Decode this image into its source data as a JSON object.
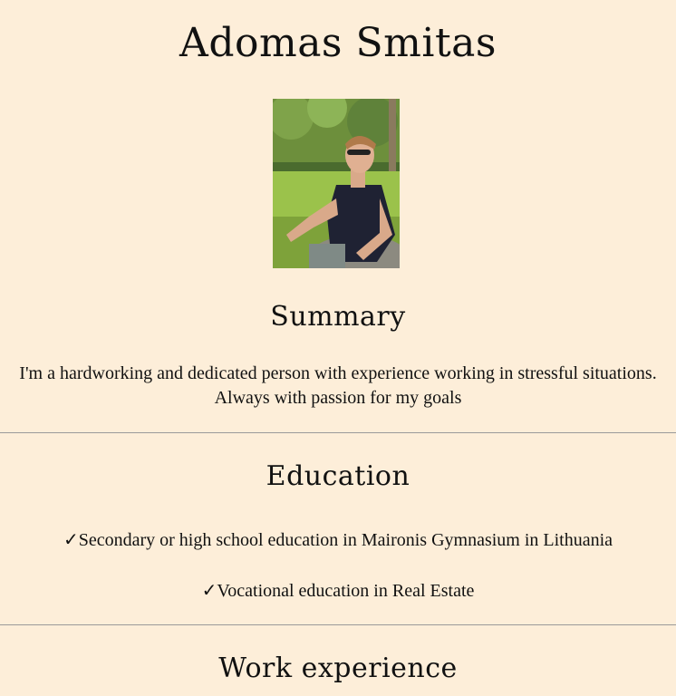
{
  "name": "Adomas Smitas",
  "photo": {
    "description_icon": "profile-photo"
  },
  "summary": {
    "title": "Summary",
    "text": "I'm a hardworking and dedicated person with experience working in stressful situations. Always with passion for my goals"
  },
  "education": {
    "title": "Education",
    "check_glyph": "✓",
    "items": [
      "Secondary or high school education in Maironis Gymnasium in Lithuania",
      "Vocational education in Real Estate"
    ]
  },
  "work": {
    "title": "Work experience"
  },
  "colors": {
    "background": "#fdeed9",
    "divider": "#9a9a9a",
    "text": "#111111"
  }
}
